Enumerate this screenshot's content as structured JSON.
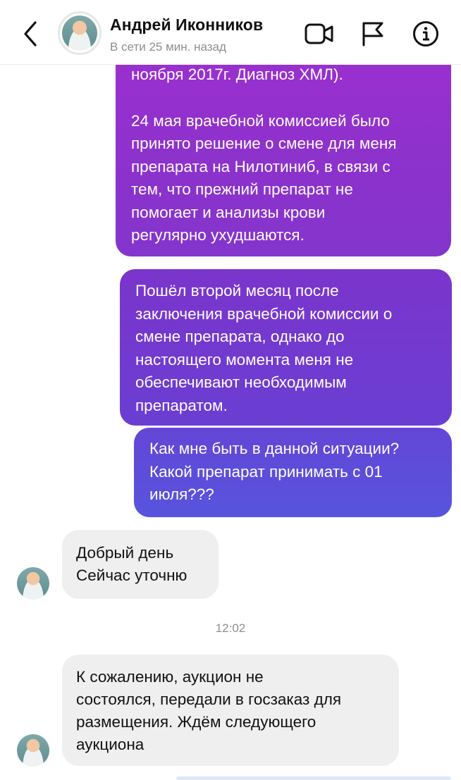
{
  "header": {
    "contact_name": "Андрей Иконников",
    "status": "В сети 25 мин. назад",
    "icons": [
      "back-chevron-icon",
      "video-call-icon",
      "flag-icon",
      "info-icon"
    ]
  },
  "messages": {
    "out1_line1": "ноября 2017г. Диагноз ХМЛ).",
    "out1_para2": [
      "24 мая врачебной комиссией было",
      "принято решение о смене для меня",
      "препарата на Нилотиниб, в связи с",
      "тем, что прежний препарат не",
      "помогает и анализы крови",
      "регулярно ухудшаются."
    ],
    "out2": [
      "Пошёл второй месяц после",
      "заключения врачебной комиссии о",
      "смене препарата, однако до",
      "настоящего момента меня не",
      "обеспечивают необходимым",
      "препаратом."
    ],
    "out3": [
      "Как мне быть в данной ситуации?",
      "Какой препарат принимать с 01",
      "июля???"
    ],
    "in1": [
      "Добрый день",
      "Сейчас уточню"
    ],
    "timestamp": "12:02",
    "in2": [
      "К сожалению, аукцион не",
      "состоялся, передали в госзаказ для",
      "размещения. Ждём следующего",
      "аукциона"
    ]
  },
  "colors": {
    "bubble_out_top": "#9a2fcf",
    "bubble_out_mid": "#7b35cc",
    "bubble_out_bottom": "#5754de",
    "bubble_in": "#efefef",
    "meta_text": "#8e8e8e"
  }
}
